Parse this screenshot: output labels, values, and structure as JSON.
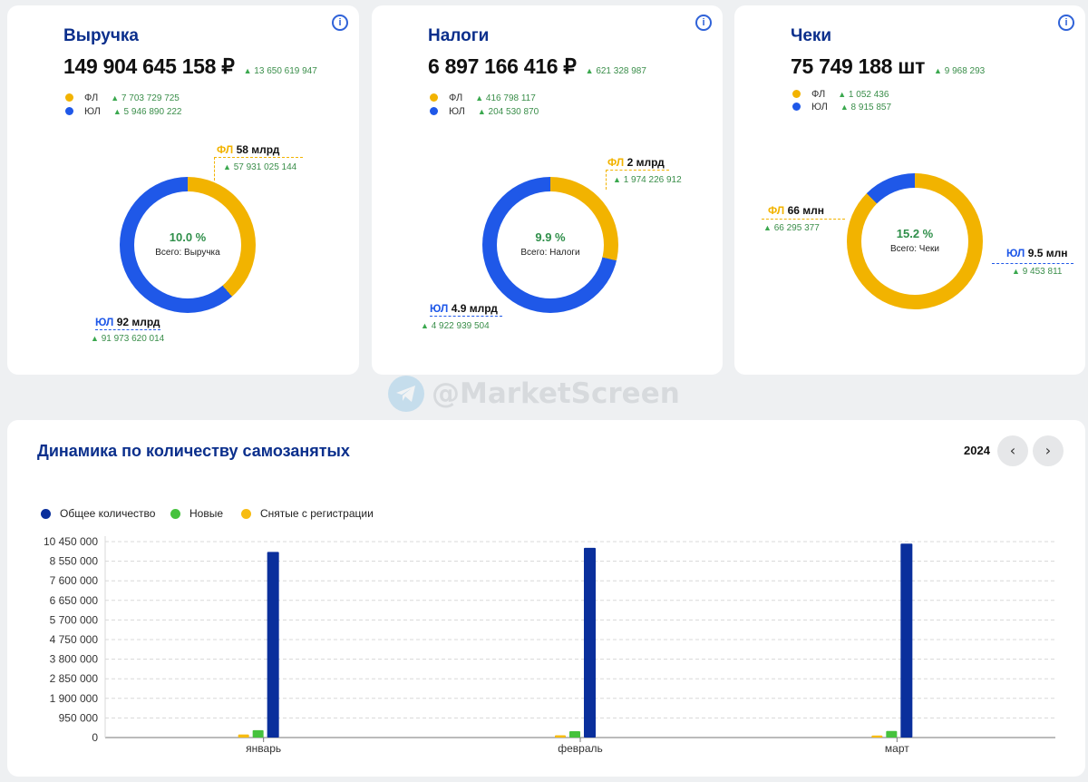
{
  "cards": [
    {
      "title": "Выручка",
      "value": "149 904 645 158 ₽",
      "delta": "13 650 619 947",
      "legend": [
        {
          "label": "ФЛ",
          "value": "7 703 729 725"
        },
        {
          "label": "ЮЛ",
          "value": "5 946 890 222"
        }
      ],
      "donut": {
        "percent": "10.0 %",
        "total_label": "Всего: Выручка",
        "fl_share": 0.387
      },
      "fl_label": {
        "key": "ФЛ",
        "value": "58 млрд",
        "sub": "57 931 025 144"
      },
      "ul_label": {
        "key": "ЮЛ",
        "value": "92 млрд",
        "sub": "91 973 620 014"
      }
    },
    {
      "title": "Налоги",
      "value": "6 897 166 416 ₽",
      "delta": "621 328 987",
      "legend": [
        {
          "label": "ФЛ",
          "value": "416 798 117"
        },
        {
          "label": "ЮЛ",
          "value": "204 530 870"
        }
      ],
      "donut": {
        "percent": "9.9 %",
        "total_label": "Всего: Налоги",
        "fl_share": 0.287
      },
      "fl_label": {
        "key": "ФЛ",
        "value": "2 млрд",
        "sub": "1 974 226 912"
      },
      "ul_label": {
        "key": "ЮЛ",
        "value": "4.9 млрд",
        "sub": "4 922 939 504"
      }
    },
    {
      "title": "Чеки",
      "value": "75 749 188 шт",
      "delta": "9 968 293",
      "legend": [
        {
          "label": "ФЛ",
          "value": "1 052 436"
        },
        {
          "label": "ЮЛ",
          "value": "8 915 857"
        }
      ],
      "donut": {
        "percent": "15.2 %",
        "total_label": "Всего: Чеки",
        "fl_share": 0.875
      },
      "fl_label": {
        "key": "ФЛ",
        "value": "66 млн",
        "sub": "66 295 377"
      },
      "ul_label": {
        "key": "ЮЛ",
        "value": "9.5 млн",
        "sub": "9 453 811"
      }
    }
  ],
  "watermark": "@MarketScreen",
  "bottom": {
    "title": "Динамика по количеству самозанятых",
    "year": "2024",
    "prev_icon": "chevron-left-icon",
    "next_icon": "chevron-right-icon"
  },
  "colors": {
    "fl": "#f2b300",
    "ul": "#1f58e8",
    "total": "#0a2f9c",
    "new": "#46c23d",
    "removed": "#f7bc12",
    "positive": "#3a8e4a"
  },
  "chart_data": {
    "type": "bar",
    "categories": [
      "январь",
      "февраль",
      "март"
    ],
    "series": [
      {
        "name": "Снятые с регистрации",
        "values": [
          150000,
          110000,
          100000
        ]
      },
      {
        "name": "Новые",
        "values": [
          360000,
          310000,
          320000
        ]
      },
      {
        "name": "Общее количество",
        "values": [
          9000000,
          9200000,
          9400000
        ]
      }
    ],
    "yticks": [
      "10 450 000",
      "8 550 000",
      "7 600 000",
      "6 650 000",
      "5 700 000",
      "4 750 000",
      "3 800 000",
      "2 850 000",
      "1 900 000",
      "950 000",
      "0"
    ],
    "ylim": [
      0,
      9500000
    ],
    "grid": true,
    "legend_position": "top-left"
  }
}
